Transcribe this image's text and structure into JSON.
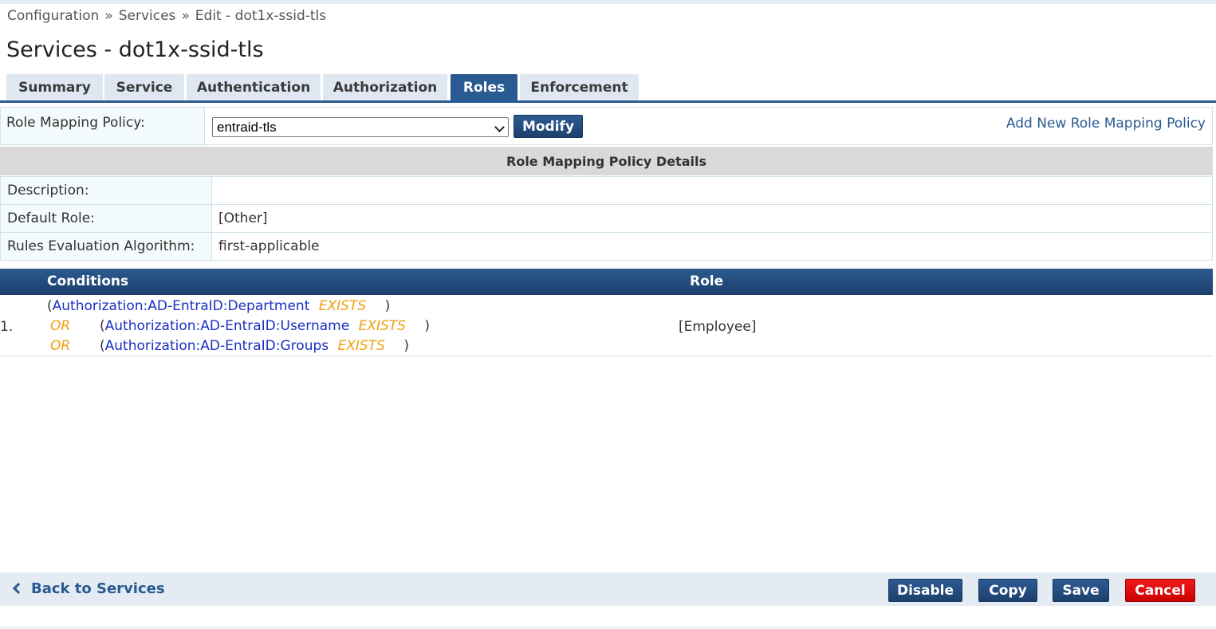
{
  "breadcrumb": [
    "Configuration",
    "Services",
    "Edit - dot1x-ssid-tls"
  ],
  "breadcrumb_separator": "»",
  "page_title": "Services - dot1x-ssid-tls",
  "tabs": [
    {
      "label": "Summary",
      "active": false
    },
    {
      "label": "Service",
      "active": false
    },
    {
      "label": "Authentication",
      "active": false
    },
    {
      "label": "Authorization",
      "active": false
    },
    {
      "label": "Roles",
      "active": true
    },
    {
      "label": "Enforcement",
      "active": false
    }
  ],
  "policy": {
    "label": "Role Mapping Policy:",
    "selected": "entraid-tls",
    "modify_label": "Modify",
    "add_link": "Add New Role Mapping Policy"
  },
  "details": {
    "header": "Role Mapping Policy Details",
    "rows": [
      {
        "label": "Description:",
        "value": ""
      },
      {
        "label": "Default Role:",
        "value": "[Other]"
      },
      {
        "label": "Rules Evaluation Algorithm:",
        "value": "first-applicable"
      }
    ]
  },
  "rules": {
    "headers": {
      "conditions": "Conditions",
      "role": "Role"
    },
    "items": [
      {
        "number": "1.",
        "conditions": [
          {
            "connector": "",
            "open": "(",
            "attribute": "Authorization:AD-EntraID:Department",
            "operator": "EXISTS",
            "close": ")"
          },
          {
            "connector": "OR",
            "open": "(",
            "attribute": "Authorization:AD-EntraID:Username",
            "operator": "EXISTS",
            "close": ")"
          },
          {
            "connector": "OR",
            "open": "(",
            "attribute": "Authorization:AD-EntraID:Groups",
            "operator": "EXISTS",
            "close": ")"
          }
        ],
        "role": "[Employee]"
      }
    ]
  },
  "footer": {
    "back_label": "Back to Services",
    "buttons": {
      "disable": "Disable",
      "copy": "Copy",
      "save": "Save",
      "cancel": "Cancel"
    }
  },
  "colors": {
    "primary": "#2a5a92",
    "attribute": "#1a2fc1",
    "operator": "#f0a010",
    "cancel": "#e01010",
    "tab_inactive": "#dfe7f1"
  },
  "icons": {
    "back": "chevron-left-icon",
    "select": "chevron-down-icon"
  }
}
